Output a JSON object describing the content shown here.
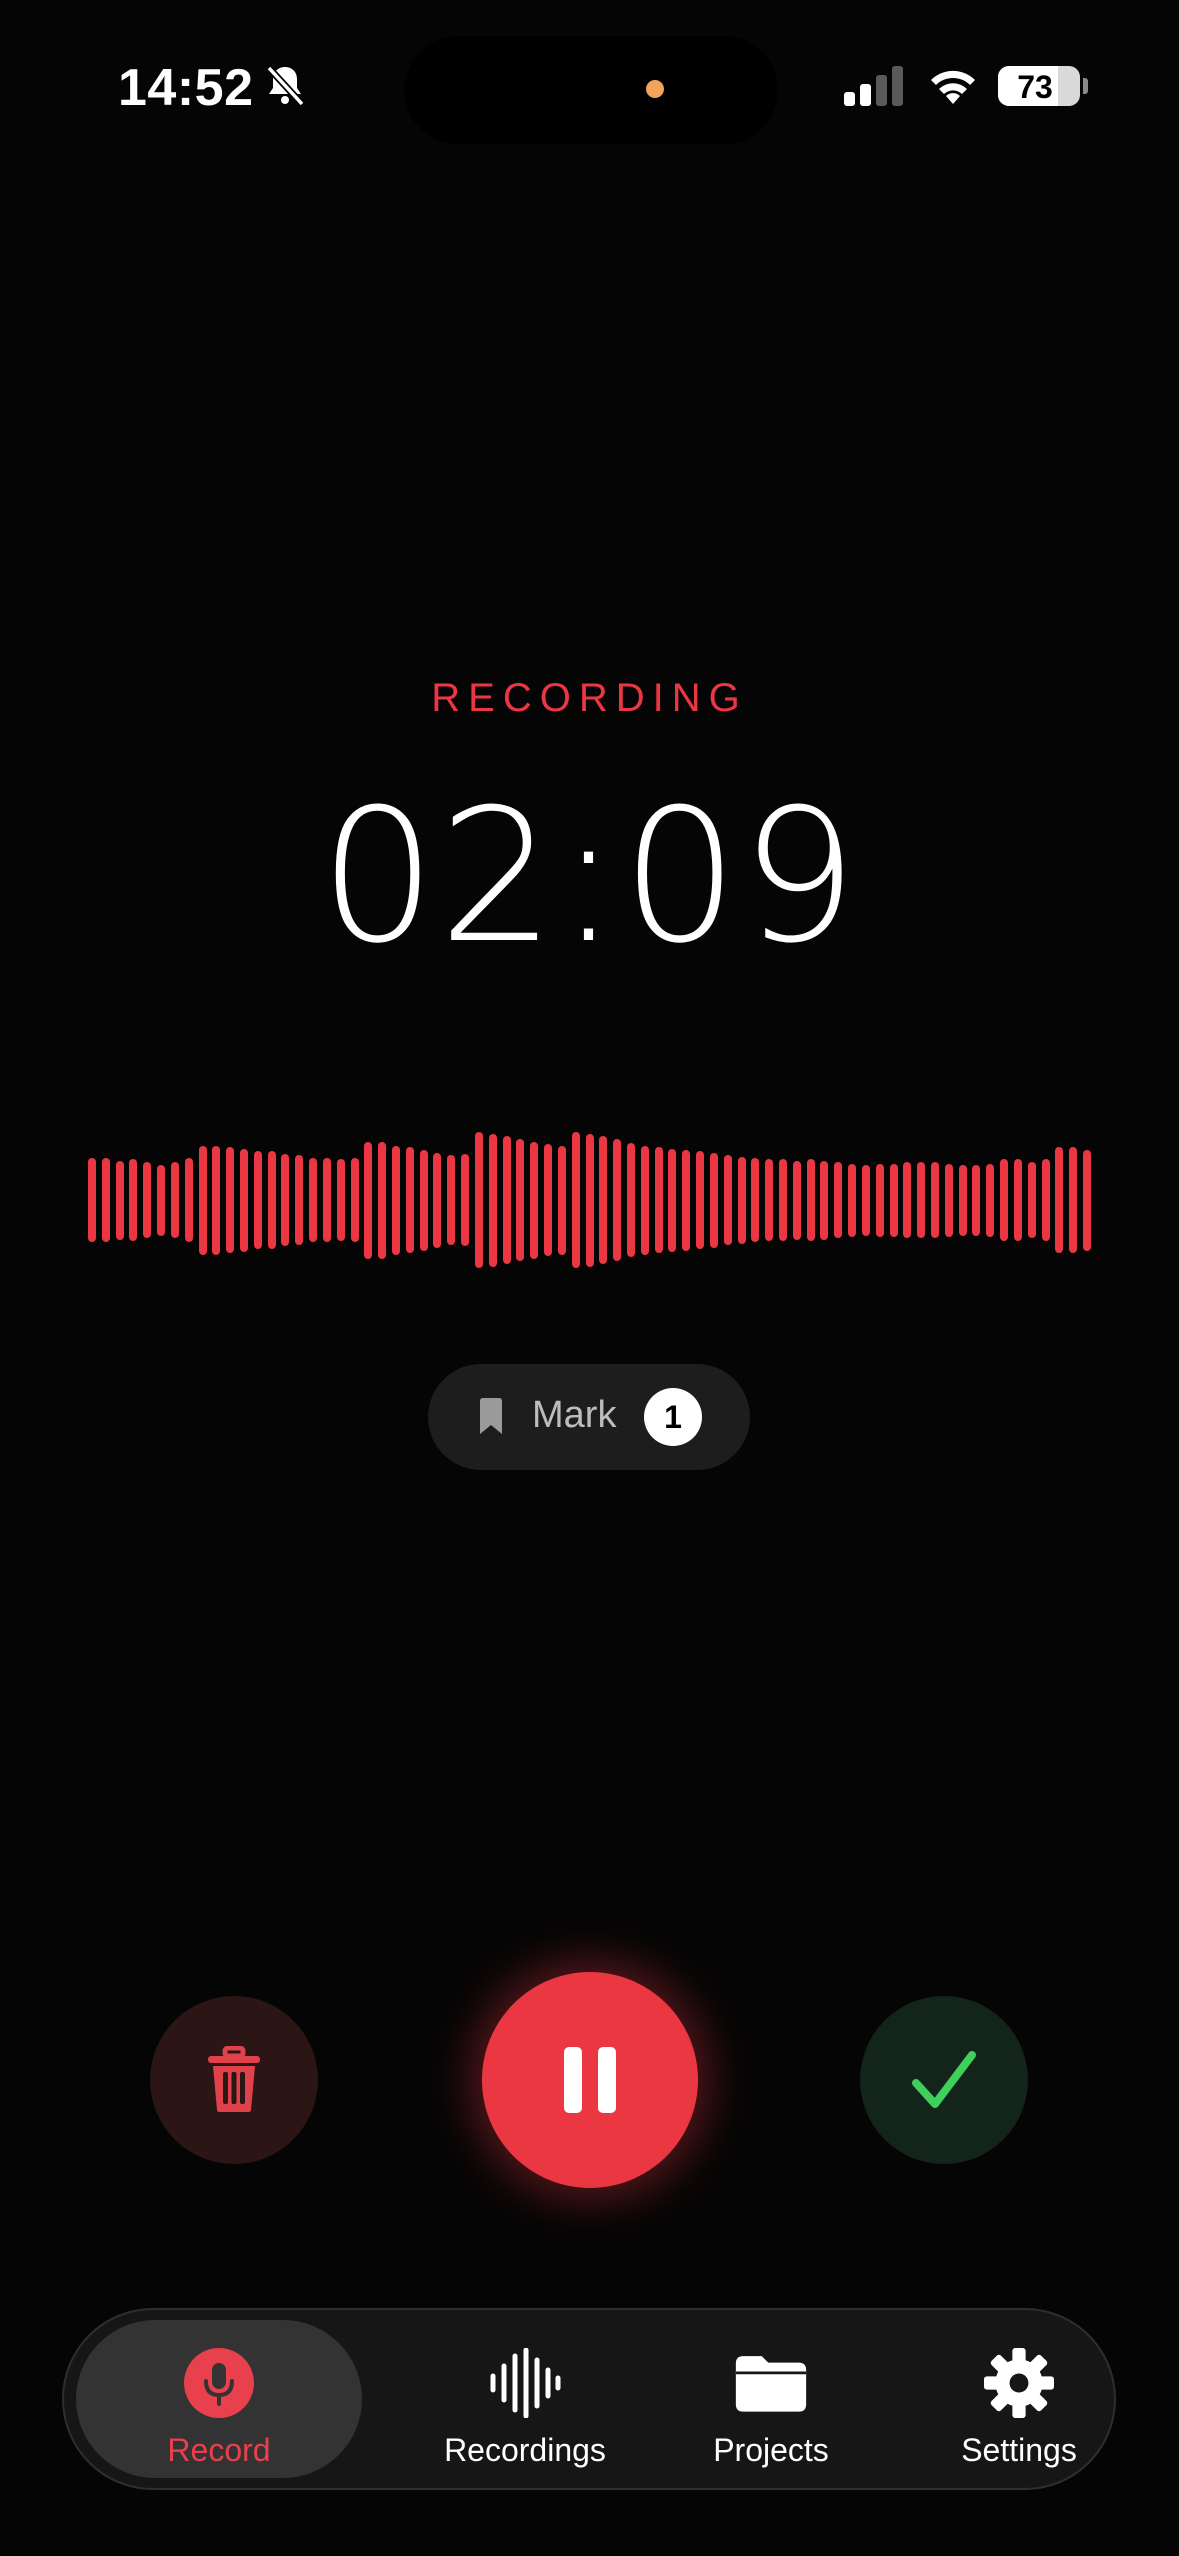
{
  "status_bar": {
    "time": "14:52",
    "battery": "73",
    "battery_level": 0.73,
    "icons": [
      "bell-slash-icon",
      "cellular-signal-icon",
      "wifi-icon",
      "battery-icon"
    ]
  },
  "recording": {
    "state_label": "RECORDING",
    "elapsed": "02:09",
    "accent_color": "#ea3743",
    "waveform_levels": [
      0.62,
      0.62,
      0.58,
      0.6,
      0.56,
      0.52,
      0.56,
      0.62,
      0.8,
      0.8,
      0.78,
      0.76,
      0.72,
      0.72,
      0.68,
      0.66,
      0.62,
      0.62,
      0.6,
      0.62,
      0.86,
      0.86,
      0.8,
      0.78,
      0.74,
      0.7,
      0.66,
      0.68,
      1.0,
      0.98,
      0.94,
      0.9,
      0.86,
      0.82,
      0.8,
      1.0,
      0.98,
      0.94,
      0.9,
      0.84,
      0.8,
      0.78,
      0.76,
      0.74,
      0.72,
      0.7,
      0.66,
      0.64,
      0.62,
      0.6,
      0.6,
      0.58,
      0.6,
      0.58,
      0.56,
      0.54,
      0.52,
      0.54,
      0.54,
      0.56,
      0.56,
      0.56,
      0.54,
      0.52,
      0.52,
      0.54,
      0.6,
      0.6,
      0.56,
      0.6,
      0.78,
      0.78,
      0.74
    ]
  },
  "mark": {
    "label": "Mark",
    "count": "1",
    "icon": "bookmark-icon"
  },
  "controls": {
    "delete_icon": "trash-icon",
    "pause_icon": "pause-icon",
    "done_icon": "checkmark-icon"
  },
  "tabs": [
    {
      "label": "Record",
      "icon": "microphone-icon",
      "active": true
    },
    {
      "label": "Recordings",
      "icon": "waveform-icon",
      "active": false
    },
    {
      "label": "Projects",
      "icon": "folder-icon",
      "active": false
    },
    {
      "label": "Settings",
      "icon": "gear-icon",
      "active": false
    }
  ]
}
